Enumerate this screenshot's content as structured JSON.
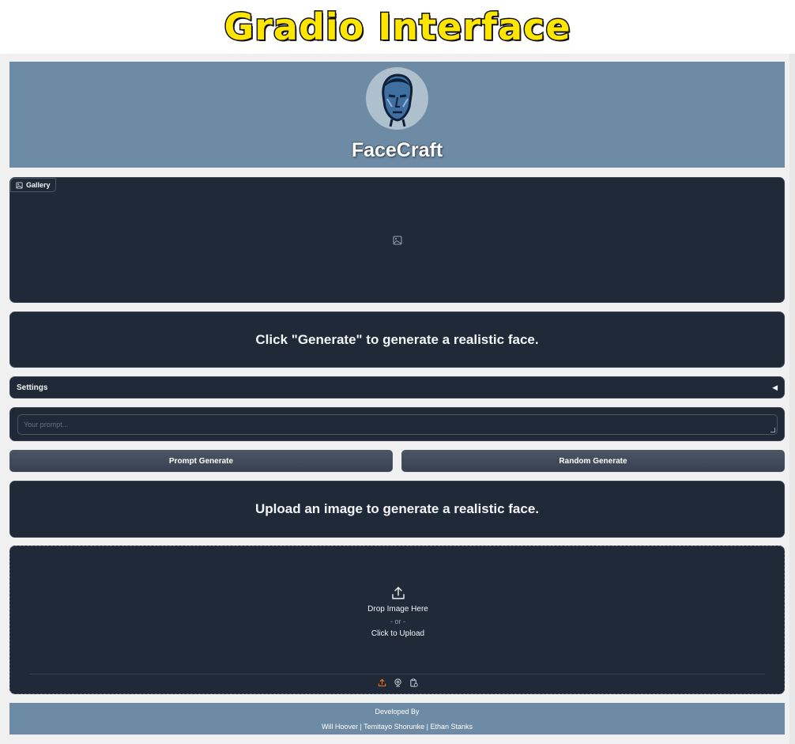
{
  "banner": {
    "title": "Gradio Interface"
  },
  "header": {
    "title": "FaceCraft"
  },
  "gallery": {
    "label": "Gallery"
  },
  "messages": {
    "generate_hint": "Click \"Generate\" to generate a realistic face.",
    "upload_hint": "Upload an image to generate a realistic face."
  },
  "settings": {
    "label": "Settings",
    "arrow": "◀"
  },
  "prompt": {
    "placeholder": "Your prompt..."
  },
  "buttons": {
    "prompt_generate": "Prompt Generate",
    "random_generate": "Random Generate"
  },
  "upload": {
    "drop": "Drop Image Here",
    "or": "- or -",
    "click": "Click to Upload",
    "sources": [
      "upload-icon",
      "webcam-icon",
      "clipboard-icon"
    ],
    "active_color": "#f97316"
  },
  "footer": {
    "developed_by": "Developed By",
    "authors": "Will Hoover | Temitayo Shorunke | Ethan Stanks"
  },
  "colors": {
    "panel_bg": "#1f2937",
    "header_bg": "#6e8ba6",
    "page_bg": "#f0f0f0",
    "banner_text": "#ffe600"
  }
}
